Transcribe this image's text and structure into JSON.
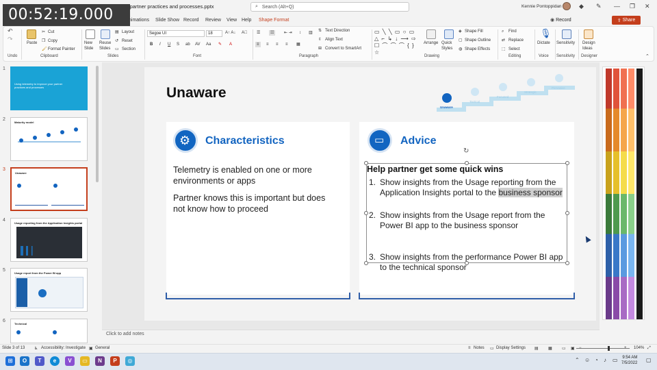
{
  "overlay": {
    "timestamp": "00:52:19.000"
  },
  "titlebar": {
    "doc_title": "r partner practices and processes.pptx",
    "search_placeholder": "Search (Alt+Q)",
    "user": "Kennie Pontoppidan"
  },
  "tabs": [
    "nimations",
    "Slide Show",
    "Record",
    "Review",
    "View",
    "Help",
    "Shape Format"
  ],
  "tab_buttons": {
    "record": "Record",
    "share": "Share"
  },
  "ribbon": {
    "clipboard": {
      "paste": "Paste",
      "cut": "Cut",
      "copy": "Copy",
      "format_painter": "Format Painter",
      "label": "Clipboard"
    },
    "undo": {
      "label": "Undo"
    },
    "slides": {
      "new_slide": "New Slide",
      "reuse": "Reuse Slides",
      "layout": "Layout",
      "reset": "Reset",
      "section": "Section",
      "label": "Slides"
    },
    "font": {
      "font_name": "Segoe UI",
      "font_size": "18",
      "label": "Font"
    },
    "paragraph": {
      "text_direction": "Text Direction",
      "align_text": "Align Text",
      "smartart": "Convert to SmartArt",
      "label": "Paragraph"
    },
    "drawing": {
      "arrange": "Arrange",
      "quick_styles": "Quick Styles",
      "shape_fill": "Shape Fill",
      "shape_outline": "Shape Outline",
      "shape_effects": "Shape Effects",
      "label": "Drawing"
    },
    "editing": {
      "find": "Find",
      "replace": "Replace",
      "select": "Select",
      "label": "Editing"
    },
    "voice": {
      "dictate": "Dictate",
      "label": "Voice"
    },
    "sensitivity": {
      "name": "Sensitivity",
      "label": "Sensitivity"
    },
    "designer": {
      "name": "Design Ideas",
      "label": "Designer"
    }
  },
  "thumbnails": [
    {
      "num": "1",
      "title": "Using telemetry to improve your partner practices and processes"
    },
    {
      "num": "2",
      "title": "Maturity model"
    },
    {
      "num": "3",
      "title": "Unaware"
    },
    {
      "num": "4",
      "title": "Usage reporting from the Application Insights portal"
    },
    {
      "num": "5",
      "title": "Usage report from the Power BI app"
    },
    {
      "num": "6",
      "title": "Technical"
    }
  ],
  "slide": {
    "title": "Unaware",
    "steps": [
      "Unaware",
      "Tactical",
      "Focused",
      "Strategic",
      "Pervasive"
    ],
    "characteristics": {
      "heading": "Characteristics",
      "p1": "Telemetry is enabled on one or more environments or apps",
      "p2": "Partner knows this is important but does not know how to proceed"
    },
    "advice": {
      "heading": "Advice",
      "subheading": "Help partner get some quick wins",
      "items": [
        {
          "num": "1.",
          "text_a": "Show insights from the Usage reporting from the Application Insights portal to the ",
          "text_hl": "business sponsor"
        },
        {
          "num": "2.",
          "text": "Show insights from the Usage report from the Power BI app to the business sponsor"
        },
        {
          "num": "3.",
          "text": "Show insights from the performance Power BI app to the technical sponsor"
        }
      ]
    }
  },
  "notes": {
    "placeholder": "Click to add notes"
  },
  "status": {
    "slide_info": "Slide 3 of 13",
    "accessibility": "Accessibility: Investigate",
    "sensitivity": "General",
    "notes": "Notes",
    "display": "Display Settings",
    "zoom": "104%"
  },
  "clock": {
    "time": "9:54 AM",
    "date": "7/5/2022"
  },
  "colors": {
    "accent": "#c43e1c",
    "blue": "#1264c0"
  }
}
